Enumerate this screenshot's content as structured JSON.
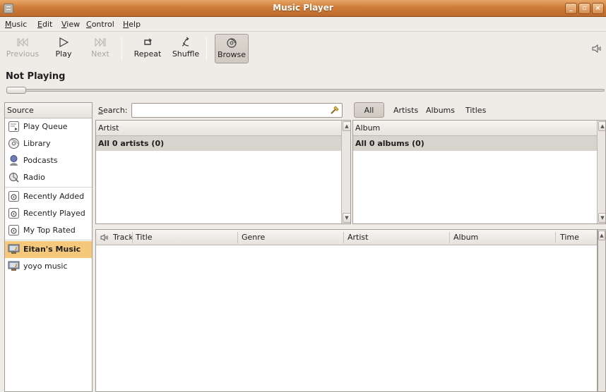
{
  "window": {
    "title": "Music Player"
  },
  "menu": [
    "Music",
    "Edit",
    "View",
    "Control",
    "Help"
  ],
  "toolbar": {
    "previous": "Previous",
    "play": "Play",
    "next": "Next",
    "repeat": "Repeat",
    "shuffle": "Shuffle",
    "browse": "Browse"
  },
  "status": {
    "now_playing": "Not Playing"
  },
  "source": {
    "header": "Source",
    "items": [
      {
        "label": "Play Queue",
        "icon": "play-queue-icon"
      },
      {
        "label": "Library",
        "icon": "library-icon"
      },
      {
        "label": "Podcasts",
        "icon": "podcast-icon"
      },
      {
        "label": "Radio",
        "icon": "radio-icon"
      },
      {
        "label": "Recently Added",
        "icon": "playlist-icon"
      },
      {
        "label": "Recently Played",
        "icon": "playlist-icon"
      },
      {
        "label": "My Top Rated",
        "icon": "playlist-icon"
      },
      {
        "label": "Eitan's Music",
        "icon": "shared-music-icon",
        "selected": true
      },
      {
        "label": "yoyo music",
        "icon": "shared-music-icon"
      }
    ]
  },
  "search": {
    "label": "Search:",
    "value": ""
  },
  "filters": {
    "all": "All",
    "artists": "Artists",
    "albums": "Albums",
    "titles": "Titles"
  },
  "artist_pane": {
    "header": "Artist",
    "row": "All 0 artists (0)"
  },
  "album_pane": {
    "header": "Album",
    "row": "All 0 albums (0)"
  },
  "track_columns": {
    "track": "Track",
    "title": "Title",
    "genre": "Genre",
    "artist": "Artist",
    "album": "Album",
    "time": "Time"
  },
  "colors": {
    "title_bar": "#cf7d3a",
    "selection": "#f5c87c",
    "window_bg": "#efebe7"
  }
}
